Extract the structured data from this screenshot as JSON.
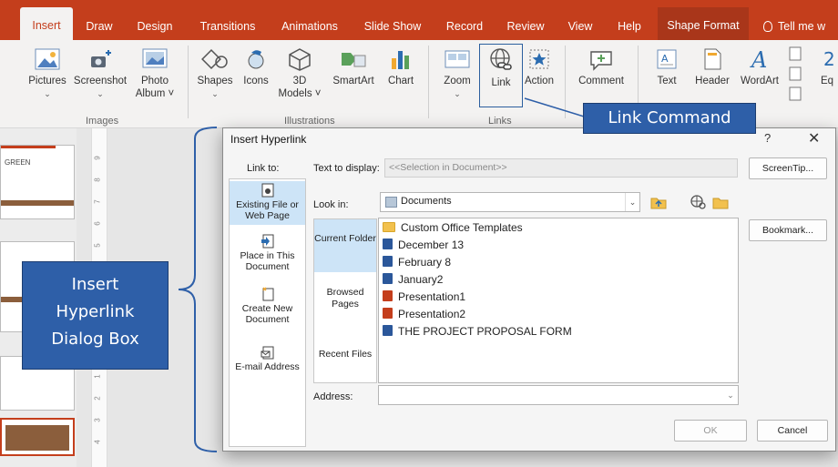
{
  "ribbon_tabs": [
    "Insert",
    "Draw",
    "Design",
    "Transitions",
    "Animations",
    "Slide Show",
    "Record",
    "Review",
    "View",
    "Help",
    "Shape Format"
  ],
  "tell_me": "Tell me w",
  "ribbon": {
    "pictures": "Pictures",
    "screenshot": "Screenshot",
    "photo_album": "Photo Album ˅",
    "shapes": "Shapes",
    "icons": "Icons",
    "models_3d": "3D Models ˅",
    "smartart": "SmartArt",
    "chart": "Chart",
    "zoom": "Zoom",
    "link": "Link",
    "action": "Action",
    "comment": "Comment",
    "text": "Text",
    "header": "Header",
    "wordart": "WordArt",
    "equation_cut": "Eq",
    "group_images": "Images",
    "group_illustrations": "Illustrations",
    "group_links": "Links"
  },
  "slide_thumb_text": "GREEN",
  "dialog": {
    "title": "Insert Hyperlink",
    "help": "?",
    "close": "✕",
    "link_to_label": "Link to:",
    "link_to_items": [
      {
        "label": "Existing File or Web Page"
      },
      {
        "label": "Place in This Document"
      },
      {
        "label": "Create New Document"
      },
      {
        "label": "E-mail Address"
      }
    ],
    "text_to_display_label": "Text to display:",
    "text_to_display_value": "<<Selection in Document>>",
    "screentip_button": "ScreenTip...",
    "look_in_label": "Look in:",
    "look_in_value": "Documents",
    "bookmark_button": "Bookmark...",
    "side_buttons": [
      "Current Folder",
      "Browsed Pages",
      "Recent Files"
    ],
    "files": [
      {
        "name": "Custom Office Templates",
        "type": "folder"
      },
      {
        "name": "December 13",
        "type": "word"
      },
      {
        "name": "February 8",
        "type": "word"
      },
      {
        "name": "January2",
        "type": "word"
      },
      {
        "name": "Presentation1",
        "type": "ppt"
      },
      {
        "name": "Presentation2",
        "type": "ppt"
      },
      {
        "name": "THE PROJECT PROPOSAL FORM",
        "type": "word"
      }
    ],
    "address_label": "Address:",
    "address_value": "",
    "ok_button": "OK",
    "cancel_button": "Cancel"
  },
  "callouts": {
    "link_command": "Link Command",
    "dialog_box": [
      "Insert",
      "Hyperlink",
      "Dialog Box"
    ]
  },
  "colors": {
    "ribbon_brand": "#c43e1c",
    "callout_blue": "#2e5fa8",
    "selection_blue": "#cde4f7"
  }
}
